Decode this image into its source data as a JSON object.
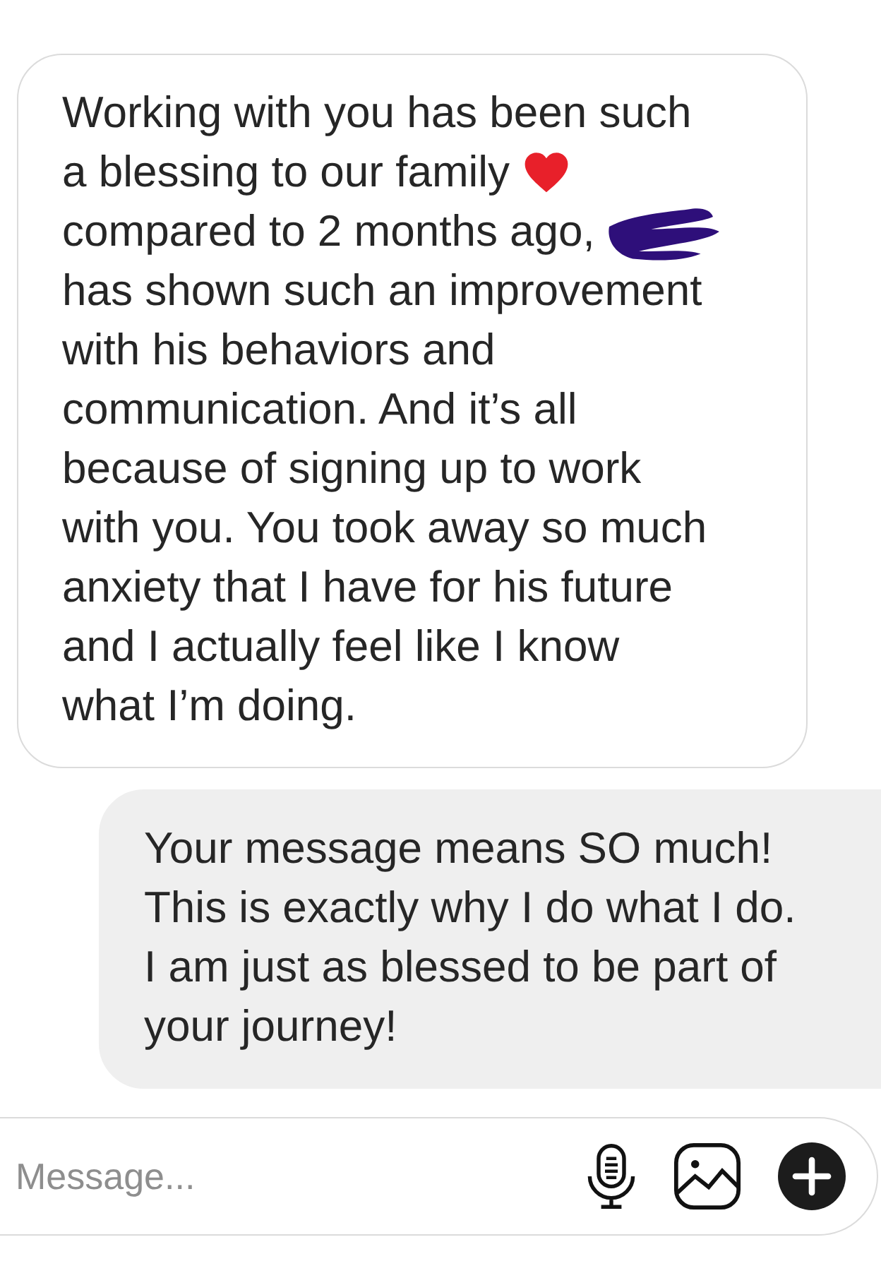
{
  "messages": [
    {
      "kind": "received",
      "lines": [
        {
          "text": "Working with you has been such",
          "kind": "plain"
        },
        {
          "text": "a blessing to our family",
          "kind": "emoji"
        },
        {
          "text": "compared to 2 months ago,",
          "kind": "redacted"
        },
        {
          "text": "has shown such an improvement",
          "kind": "plain"
        },
        {
          "text": "with his behaviors and",
          "kind": "plain"
        },
        {
          "text": "communication. And it’s all",
          "kind": "plain"
        },
        {
          "text": "because of signing up to work",
          "kind": "plain"
        },
        {
          "text": "with you. You took away so much",
          "kind": "plain"
        },
        {
          "text": "anxiety that I have for his future",
          "kind": "plain"
        },
        {
          "text": "and I actually feel like I know",
          "kind": "plain"
        },
        {
          "text": "what I’m doing.",
          "kind": "plain"
        }
      ]
    },
    {
      "kind": "sent",
      "lines": [
        {
          "text": "Your message means SO much!",
          "kind": "plain"
        },
        {
          "text": "This is exactly why I do what I do.",
          "kind": "plain"
        },
        {
          "text": "I am just as blessed to be part of",
          "kind": "plain"
        },
        {
          "text": "your journey!",
          "kind": "plain"
        }
      ]
    }
  ],
  "composer": {
    "placeholder": "Message..."
  }
}
